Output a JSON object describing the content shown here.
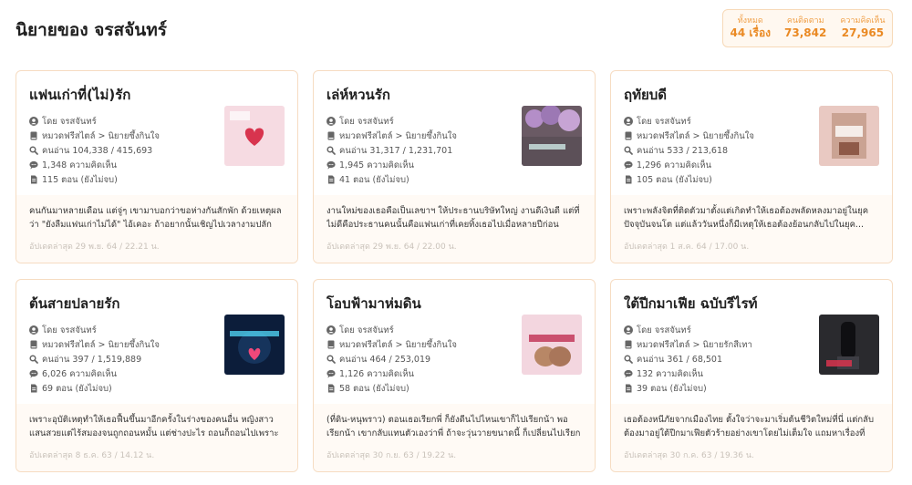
{
  "page": {
    "title": "นิยายของ จรสจันทร์"
  },
  "stats": [
    {
      "label": "ทั้งหมด",
      "value": "44 เรื่อง"
    },
    {
      "label": "คนติดตาม",
      "value": "73,842"
    },
    {
      "label": "ความคิดเห็น",
      "value": "27,965"
    }
  ],
  "novels": [
    {
      "title": "แฟนเก่าที่(ไม่)รัก",
      "author": "โดย จรสจันทร์",
      "category": "หมวดฟรีสไตล์ > นิยายซึ้งกินใจ",
      "reads": "คนอ่าน 104,338 / 415,693",
      "comments": "1,348 ความคิดเห็น",
      "chapters": "115 ตอน (ยังไม่จบ)",
      "cover_text": "แฟนเก่าที่(ไม่)รัก",
      "synopsis": "คนกันมาหลายเดือน แต่จู่ๆ เขามาบอกว่าขอห่างกันสักพัก ด้วยเหตุผลว่า \"ยังลืมแฟนเก่าไม่ได้\" ไอ้เคอะ ถ้าอยากนั้นเชิญไปเวลางามปลักอยู่...",
      "updated": "อัปเดตล่าสุด 29 พ.ย. 64 / 22.21 น."
    },
    {
      "title": "เล่ห์หวนรัก",
      "author": "โดย จรสจันทร์",
      "category": "หมวดฟรีสไตล์ > นิยายซึ้งกินใจ",
      "reads": "คนอ่าน 31,317 / 1,231,701",
      "comments": "1,945 ความคิดเห็น",
      "chapters": "41 ตอน (ยังไม่จบ)",
      "cover_text": "เล่ห์หวนรัก",
      "synopsis": "งานใหม่ของเธอคือเป็นเลขาฯ ให้ประธานบริษัทใหญ่ งานดีเงินดี แต่ที่ไม่ดีคือประธานคนนั้นคือแฟนเก่าที่เคยทิ้งเธอไปเมื่อหลายปีก่อน เธอ...",
      "updated": "อัปเดตล่าสุด 29 พ.ย. 64 / 22.00 น."
    },
    {
      "title": "ฤทัยบดี",
      "author": "โดย จรสจันทร์",
      "category": "หมวดฟรีสไตล์ > นิยายซึ้งกินใจ",
      "reads": "คนอ่าน 533 / 213,618",
      "comments": "1,296 ความคิดเห็น",
      "chapters": "105 ตอน (ยังไม่จบ)",
      "cover_text": "ฤทัยบดี",
      "synopsis": "เพราะพลังจิตที่ติดตัวมาตั้งแต่เกิดทำให้เธอต้องพลัดหลงมาอยู่ในยุคปัจจุบันจนโต แต่แล้ววันหนึ่งก็มีเหตุให้เธอต้องย้อนกลับไปในยุค...",
      "updated": "อัปเดตล่าสุด 1 ส.ค. 64 / 17.00 น."
    },
    {
      "title": "ต้นสายปลายรัก",
      "author": "โดย จรสจันทร์",
      "category": "หมวดฟรีสไตล์ > นิยายซึ้งกินใจ",
      "reads": "คนอ่าน 397 / 1,519,889",
      "comments": "6,026 ความคิดเห็น",
      "chapters": "69 ตอน (ยังไม่จบ)",
      "cover_text": "ต้นสายปลายรัก",
      "synopsis": "เพราะอุบัติเหตุทำให้เธอฟื้นขึ้นมาอีกครั้งในร่างของคนอื่น หญิงสาวแสนสวยแต่ไร้สมองจนถูกถอนหมั้น แต่ช่างปะไร ถอนก็ถอนไปเพราะเขา...",
      "updated": "อัปเดตล่าสุด 8 ธ.ค. 63 / 14.12 น."
    },
    {
      "title": "โอบฟ้ามาห่มดิน",
      "author": "โดย จรสจันทร์",
      "category": "หมวดฟรีสไตล์ > นิยายซึ้งกินใจ",
      "reads": "คนอ่าน 464 / 253,019",
      "comments": "1,126 ความคิดเห็น",
      "chapters": "58 ตอน (ยังไม่จบ)",
      "cover_text": "โอบฟ้ามาห่มดิน",
      "synopsis": "(ที่ดิน-หนุพราว) ตอนเธอเรียกพี่ ก็ยังดีนไปไหนเขาก็ไปเรียกน้า พอเรียกน้า เขากลับแทนตัวเองว่าพี่ ถ้าจะวุ่นวายขนาดนี้ ก็เปลี่ยนไปเรียก \"คุณสามี\" เลย...",
      "updated": "อัปเดตล่าสุด 30 ก.ย. 63 / 19.22 น."
    },
    {
      "title": "ใต้ปีกมาเฟีย ฉบับรีไรท์",
      "author": "โดย จรสจันทร์",
      "category": "หมวดฟรีสไตล์ > นิยายรักสีเทา",
      "reads": "คนอ่าน 361 / 68,501",
      "comments": "132 ความคิดเห็น",
      "chapters": "39 ตอน (ยังไม่จบ)",
      "cover_text": "ใต้ปีกมาเฟีย",
      "synopsis": "เธอต้องหนีภัยจากเมืองไทย ตั้งใจว่าจะมาเริ่มต้นชีวิตใหม่ที่นี่ แต่กลับต้องมาอยู่ใต้ปีกมาเฟียตัวร้ายอย่างเขาโดยไม่เต็มใจ แถมหาเรื่องที่ไม่...",
      "updated": "อัปเดตล่าสุด 30 ก.ค. 63 / 19.36 น."
    }
  ]
}
